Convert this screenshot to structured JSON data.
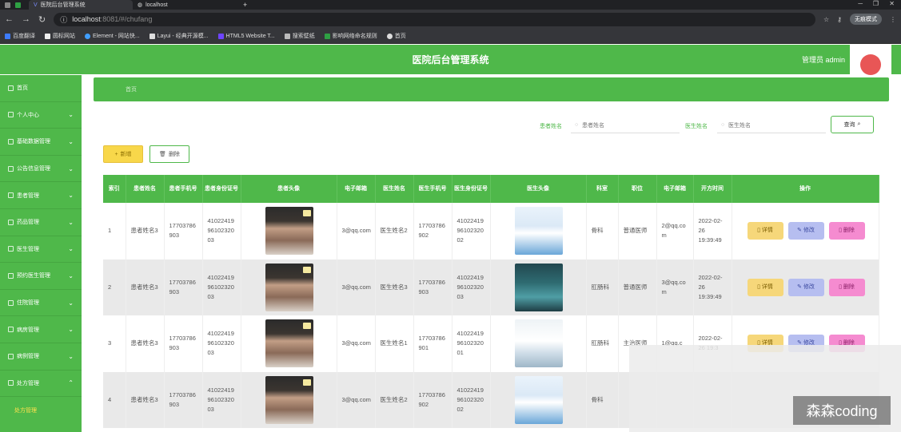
{
  "browser": {
    "tabs": [
      {
        "title": "医院后台管理系统",
        "active": true
      },
      {
        "title": "localhost",
        "active": false
      }
    ],
    "new_tab": "+",
    "url_host": "localhost",
    "url_rest": ":8081/#/chufang",
    "incognito": "无痕模式",
    "bookmarks": [
      "百度翻译",
      "圆标网站",
      "Element - 网站快...",
      "Layui - 经典开源模...",
      "HTML5 Website T...",
      "搜索壁纸",
      "影响网络命名规则",
      "首页"
    ]
  },
  "app": {
    "title": "医院后台管理系统",
    "admin_label": "管理员 admin"
  },
  "sidebar": {
    "items": [
      {
        "label": "首页",
        "has_arrow": false
      },
      {
        "label": "个人中心",
        "has_arrow": true
      },
      {
        "label": "基础数据管理",
        "has_arrow": true
      },
      {
        "label": "公告信息管理",
        "has_arrow": true
      },
      {
        "label": "患者管理",
        "has_arrow": true
      },
      {
        "label": "药品管理",
        "has_arrow": true
      },
      {
        "label": "医生管理",
        "has_arrow": true
      },
      {
        "label": "预约医生管理",
        "has_arrow": true
      },
      {
        "label": "住院管理",
        "has_arrow": true
      },
      {
        "label": "病房管理",
        "has_arrow": true
      },
      {
        "label": "病例管理",
        "has_arrow": true
      },
      {
        "label": "处方管理",
        "has_arrow": true
      }
    ],
    "active_sub": "处方管理"
  },
  "breadcrumb": "首页",
  "search": {
    "patient_label": "患者姓名",
    "patient_placeholder": "患者姓名",
    "doctor_label": "医生姓名",
    "doctor_placeholder": "医生姓名",
    "query_button": "查询"
  },
  "toolbar": {
    "add_button": "新增",
    "delete_button": "删除"
  },
  "table": {
    "headers": [
      "索引",
      "患者姓名",
      "患者手机号",
      "患者身份证号",
      "患者头像",
      "电子邮箱",
      "医生姓名",
      "医生手机号",
      "医生身份证号",
      "医生头像",
      "科室",
      "职位",
      "电子邮箱",
      "开方时间",
      "操作"
    ],
    "rows": [
      {
        "index": "1",
        "patient": "患者姓名3",
        "p_phone": "17703786903",
        "p_id": "410224199610232003",
        "p_email": "3@qq.com",
        "doctor": "医生姓名2",
        "d_phone": "17703786902",
        "d_id": "410224199610232002",
        "dept": "骨科",
        "title": "普通医师",
        "d_email": "2@qq.com",
        "time": "2022-02-26 19:39:49"
      },
      {
        "index": "2",
        "patient": "患者姓名3",
        "p_phone": "17703786903",
        "p_id": "410224199610232003",
        "p_email": "3@qq.com",
        "doctor": "医生姓名3",
        "d_phone": "17703786903",
        "d_id": "410224199610232003",
        "dept": "肛肠科",
        "title": "普通医师",
        "d_email": "3@qq.com",
        "time": "2022-02-26 19:39:49"
      },
      {
        "index": "3",
        "patient": "患者姓名3",
        "p_phone": "17703786903",
        "p_id": "410224199610232003",
        "p_email": "3@qq.com",
        "doctor": "医生姓名1",
        "d_phone": "17703786901",
        "d_id": "410224199610232001",
        "dept": "肛肠科",
        "title": "主治医师",
        "d_email": "1@qq.c",
        "time": "2022-02-26 19:3"
      },
      {
        "index": "4",
        "patient": "患者姓名3",
        "p_phone": "17703786903",
        "p_id": "410224199610232003",
        "p_email": "3@qq.com",
        "doctor": "医生姓名2",
        "d_phone": "17703786902",
        "d_id": "410224199610232002",
        "dept": "骨科",
        "title": "",
        "d_email": "",
        "time": ""
      }
    ],
    "actions": {
      "detail": "详情",
      "edit": "修改",
      "remove": "删除"
    }
  },
  "watermark": "森森coding"
}
